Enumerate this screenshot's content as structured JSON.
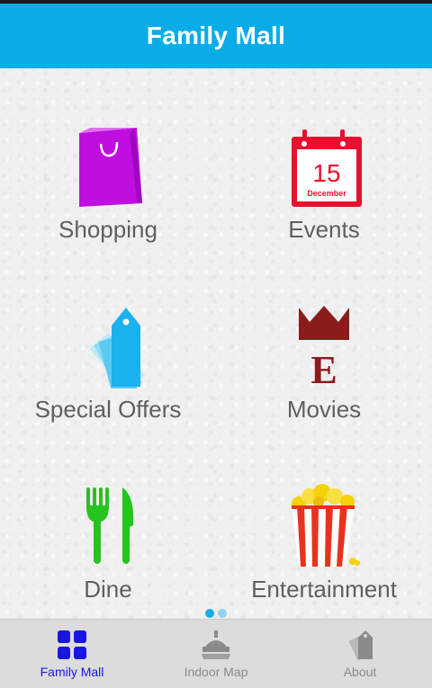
{
  "app": {
    "title": "Family Mall"
  },
  "tiles": [
    {
      "label": "Shopping",
      "icon": "shopping-bag-icon"
    },
    {
      "label": "Events",
      "icon": "calendar-icon",
      "day": "15",
      "month": "December"
    },
    {
      "label": "Special Offers",
      "icon": "price-tag-icon"
    },
    {
      "label": "Movies",
      "icon": "crown-movies-icon",
      "letter": "E"
    },
    {
      "label": "Dine",
      "icon": "fork-knife-icon"
    },
    {
      "label": "Entertainment",
      "icon": "popcorn-icon"
    }
  ],
  "pager": {
    "pages": 2,
    "current": 1
  },
  "bottom_nav": [
    {
      "label": "Family Mall",
      "icon": "grid-icon",
      "active": true
    },
    {
      "label": "Indoor Map",
      "icon": "map-icon",
      "active": false
    },
    {
      "label": "About",
      "icon": "tags-icon",
      "active": false
    }
  ],
  "colors": {
    "app_bar": "#0aace8",
    "active_nav": "#1a14e0",
    "shopping": "#c00ee0",
    "events": "#e8102e",
    "offers": "#19b2ec",
    "movies": "#8b1c1c",
    "dine": "#25c41e",
    "popcorn": "#e8321e"
  }
}
